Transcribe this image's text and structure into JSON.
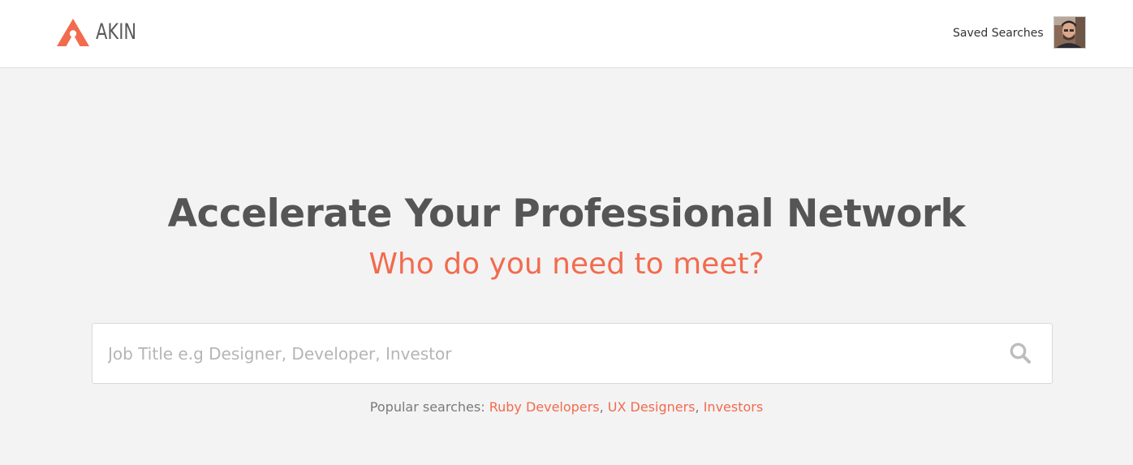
{
  "header": {
    "logo_text": "AKIN",
    "saved_searches_label": "Saved Searches",
    "avatar_icon": "user-avatar"
  },
  "hero": {
    "title": "Accelerate Your Professional Network",
    "subtitle": "Who do you need to meet?"
  },
  "search": {
    "placeholder": "Job Title e.g Designer, Developer, Investor",
    "value": "",
    "button_icon": "search-icon"
  },
  "popular": {
    "label": "Popular searches:",
    "items": [
      {
        "label": "Ruby Developers"
      },
      {
        "label": "UX Designers"
      },
      {
        "label": "Investors"
      }
    ],
    "separator": ","
  },
  "colors": {
    "accent": "#f26b4f",
    "text_dark": "#555555",
    "background": "#f3f3f3"
  }
}
